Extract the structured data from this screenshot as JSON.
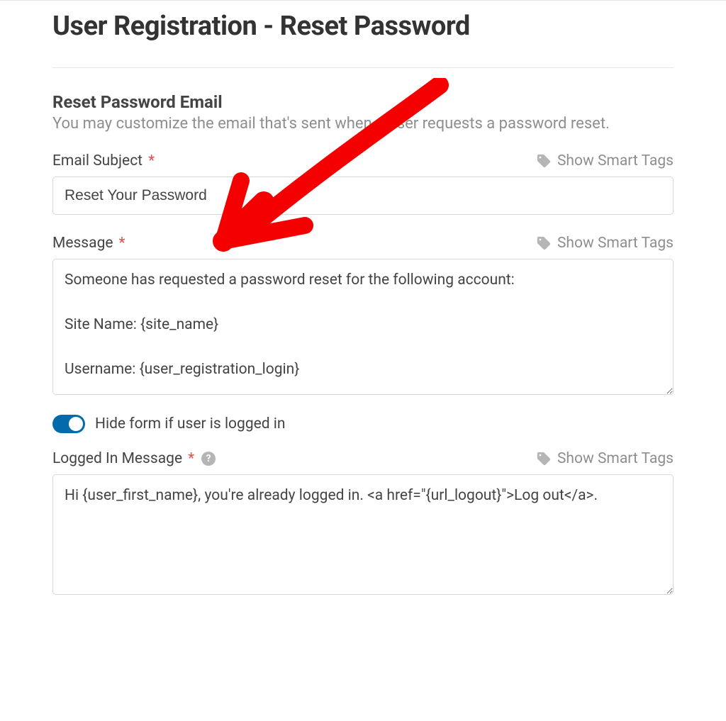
{
  "page": {
    "title": "User Registration - Reset Password"
  },
  "section": {
    "title": "Reset Password Email",
    "description": "You may customize the email that's sent when a user requests a password reset."
  },
  "fields": {
    "subject": {
      "label": "Email Subject",
      "required": "*",
      "smart_tags": "Show Smart Tags",
      "value": "Reset Your Password"
    },
    "message": {
      "label": "Message",
      "required": "*",
      "smart_tags": "Show Smart Tags",
      "value": "Someone has requested a password reset for the following account:\n\nSite Name: {site_name}\n\nUsername: {user_registration_login}"
    },
    "hide_form": {
      "label": "Hide form if user is logged in",
      "enabled": true
    },
    "logged_in_message": {
      "label": "Logged In Message",
      "required": "*",
      "smart_tags": "Show Smart Tags",
      "value": "Hi {user_first_name}, you're already logged in. <a href=\"{url_logout}\">Log out</a>."
    }
  },
  "icons": {
    "tag": "tag-icon",
    "help": "?"
  }
}
